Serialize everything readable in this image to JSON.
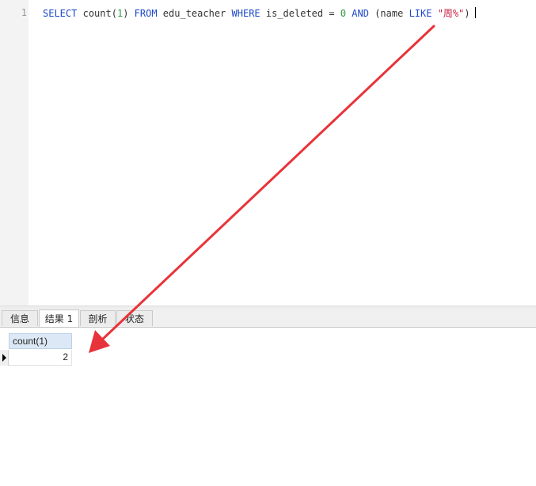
{
  "editor": {
    "line_number": "1",
    "sql": {
      "select": "SELECT",
      "count_fn": "count(",
      "count_arg": "1",
      "count_close": ")",
      "from": "FROM",
      "table": "edu_teacher",
      "where": "WHERE",
      "column": "is_deleted =",
      "value": "0",
      "and": "AND",
      "paren_open": "(name",
      "like": "LIKE",
      "pattern": "\"周%\"",
      "paren_close": ")"
    }
  },
  "result_tabs": [
    {
      "label": "信息",
      "active": false
    },
    {
      "label": "结果 1",
      "active": true
    },
    {
      "label": "剖析",
      "active": false
    },
    {
      "label": "状态",
      "active": false
    }
  ],
  "result_grid": {
    "columns": [
      "count(1)"
    ],
    "rows": [
      [
        "2"
      ]
    ]
  },
  "colors": {
    "keyword": "#1c47c9",
    "number": "#2e9a3e",
    "string": "#c71f3f",
    "annotation_arrow": "#e8333a"
  }
}
